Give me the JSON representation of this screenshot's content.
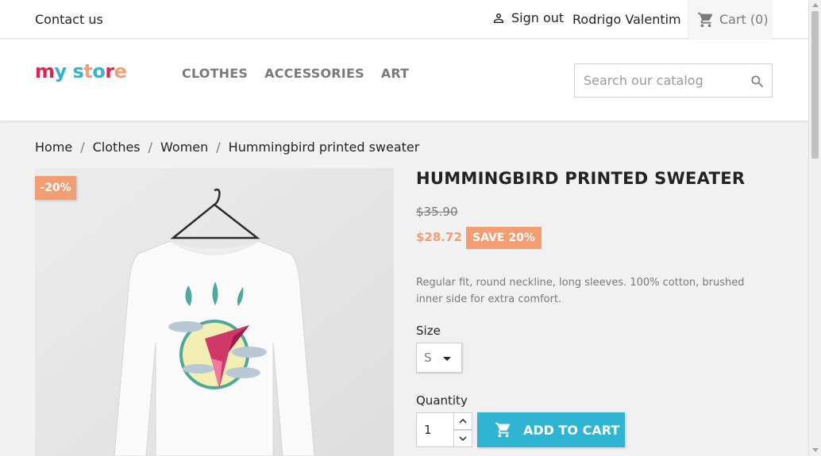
{
  "topbar": {
    "contact": "Contact us",
    "signout": "Sign out",
    "username": "Rodrigo Valentim",
    "cart": "Cart (0)"
  },
  "header": {
    "logo": [
      "m",
      "y",
      " ",
      "s",
      "t",
      "o",
      "r",
      "e"
    ],
    "logo_colors": [
      "#e7204f",
      "#2fb5d2",
      "#ffffff",
      "#2fb5d2",
      "#f39d72",
      "#2fb5d2",
      "#e7204f",
      "#f39d72"
    ],
    "nav": [
      "CLOTHES",
      "ACCESSORIES",
      "ART"
    ],
    "search_placeholder": "Search our catalog"
  },
  "breadcrumb": [
    "Home",
    "Clothes",
    "Women",
    "Hummingbird printed sweater"
  ],
  "product": {
    "flag": "-20%",
    "title": "HUMMINGBIRD PRINTED SWEATER",
    "old_price": "$35.90",
    "price": "$28.72",
    "save": "SAVE 20%",
    "description": "Regular fit, round neckline, long sleeves. 100% cotton, brushed inner side for extra comfort.",
    "size_label": "Size",
    "size_value": "S",
    "qty_label": "Quantity",
    "qty_value": "1",
    "add_to_cart": "ADD TO CART"
  },
  "colors": {
    "accent": "#2fb5d2",
    "sale": "#f39d72"
  }
}
